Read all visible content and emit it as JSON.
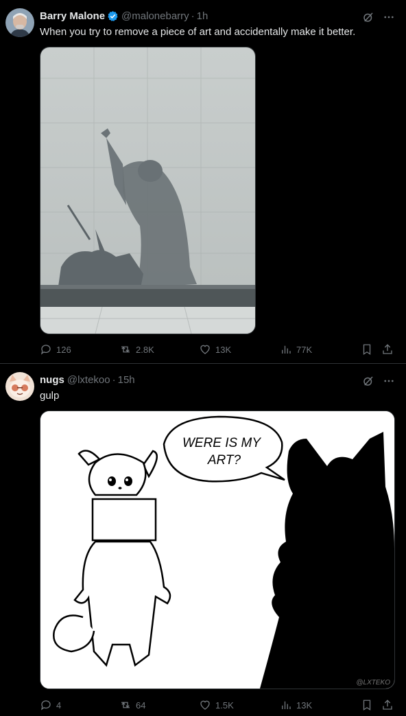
{
  "tweets": [
    {
      "author": {
        "name": "Barry Malone",
        "handle": "@malonebarry",
        "time": "1h",
        "verified": true
      },
      "text": "When you try to remove a piece of art and accidentally make it better.",
      "media": {
        "kind": "photo",
        "description_icon": "faded-mural-photo"
      },
      "stats": {
        "replies": "126",
        "reposts": "2.8K",
        "likes": "13K",
        "views": "77K"
      }
    },
    {
      "author": {
        "name": "nugs",
        "handle": "@lxtekoo",
        "time": "15h",
        "verified": false
      },
      "text": "gulp",
      "media": {
        "kind": "illustration",
        "speech_line1": "WERE IS MY",
        "speech_line2": "ART?",
        "watermark": "@LXTEKO"
      },
      "stats": {
        "replies": "4",
        "reposts": "64",
        "likes": "1.5K",
        "views": "13K"
      }
    }
  ],
  "dot": "·",
  "colors": {
    "bg": "#000000",
    "text": "#e7e9ea",
    "muted": "#71767b",
    "verified": "#1d9bf0",
    "divider": "#2f3336"
  }
}
